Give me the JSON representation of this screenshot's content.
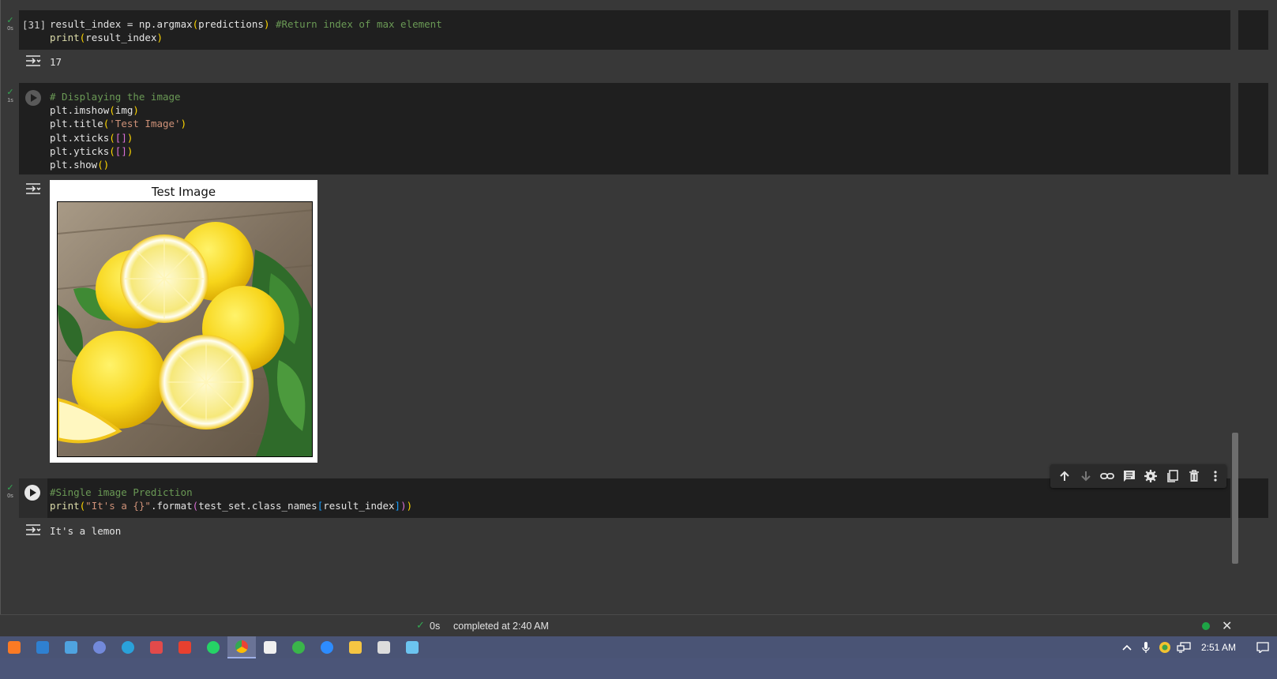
{
  "cells": [
    {
      "exec_count": "[31]",
      "duration": "0s",
      "code_lines": {
        "l1_a": "result_index = np.argmax",
        "l1_b": "(",
        "l1_c": "predictions",
        "l1_d": ")",
        "l1_e": " #Return index of max element",
        "l2_a": "print",
        "l2_b": "(",
        "l2_c": "result_index",
        "l2_d": ")"
      },
      "output": "17"
    },
    {
      "duration": "1s",
      "code_lines": {
        "l1": "# Displaying the image",
        "l2_a": "plt.imshow",
        "l2_b": "(",
        "l2_c": "img",
        "l2_d": ")",
        "l3_a": "plt.title",
        "l3_b": "(",
        "l3_c": "'Test Image'",
        "l3_d": ")",
        "l4_a": "plt.xticks",
        "l4_b": "(",
        "l4_c": "[]",
        "l4_d": ")",
        "l5_a": "plt.yticks",
        "l5_b": "(",
        "l5_c": "[]",
        "l5_d": ")",
        "l6_a": "plt.show",
        "l6_b": "()"
      },
      "figure_title": "Test Image"
    },
    {
      "duration": "0s",
      "code_lines": {
        "l1": "#Single image Prediction",
        "l2_a": "print",
        "l2_b": "(",
        "l2_c": "\"It's a {}\"",
        "l2_d": ".format",
        "l2_e": "(",
        "l2_f": "test_set.class_names",
        "l2_g": "[",
        "l2_h": "result_index",
        "l2_i": "]",
        "l2_j": ")",
        "l2_k": ")"
      },
      "output": "It's a lemon"
    }
  ],
  "toolbar_icons": [
    "arrow-up-icon",
    "arrow-down-icon",
    "link-icon",
    "comment-icon",
    "gear-icon",
    "mirror-cell-icon",
    "trash-icon",
    "more-vert-icon"
  ],
  "status": {
    "time": "0s",
    "completed": "completed at 2:40 AM"
  },
  "taskbar": {
    "clock": "2:51 AM",
    "apps": [
      {
        "name": "xampp-icon",
        "color": "#fb7a24"
      },
      {
        "name": "vscode-icon",
        "color": "#2f80d1"
      },
      {
        "name": "app-grid-icon",
        "color": "#4fa3e0"
      },
      {
        "name": "discord-icon",
        "color": "#7289da"
      },
      {
        "name": "telegram-icon",
        "color": "#2aa1da"
      },
      {
        "name": "recorder-icon",
        "color": "#e24a4a"
      },
      {
        "name": "wps-icon",
        "color": "#e8402f"
      },
      {
        "name": "whatsapp-icon",
        "color": "#25d366"
      },
      {
        "name": "chrome-icon",
        "color": "#f4b400"
      },
      {
        "name": "notion-icon",
        "color": "#f0f0f0"
      },
      {
        "name": "refresh-app-icon",
        "color": "#3ab54a"
      },
      {
        "name": "zoom-icon",
        "color": "#2d8cff"
      },
      {
        "name": "file-explorer-icon",
        "color": "#f5c542"
      },
      {
        "name": "terminal-icon",
        "color": "#dcdcdc"
      },
      {
        "name": "paint-app-icon",
        "color": "#6cc4f0"
      }
    ]
  }
}
